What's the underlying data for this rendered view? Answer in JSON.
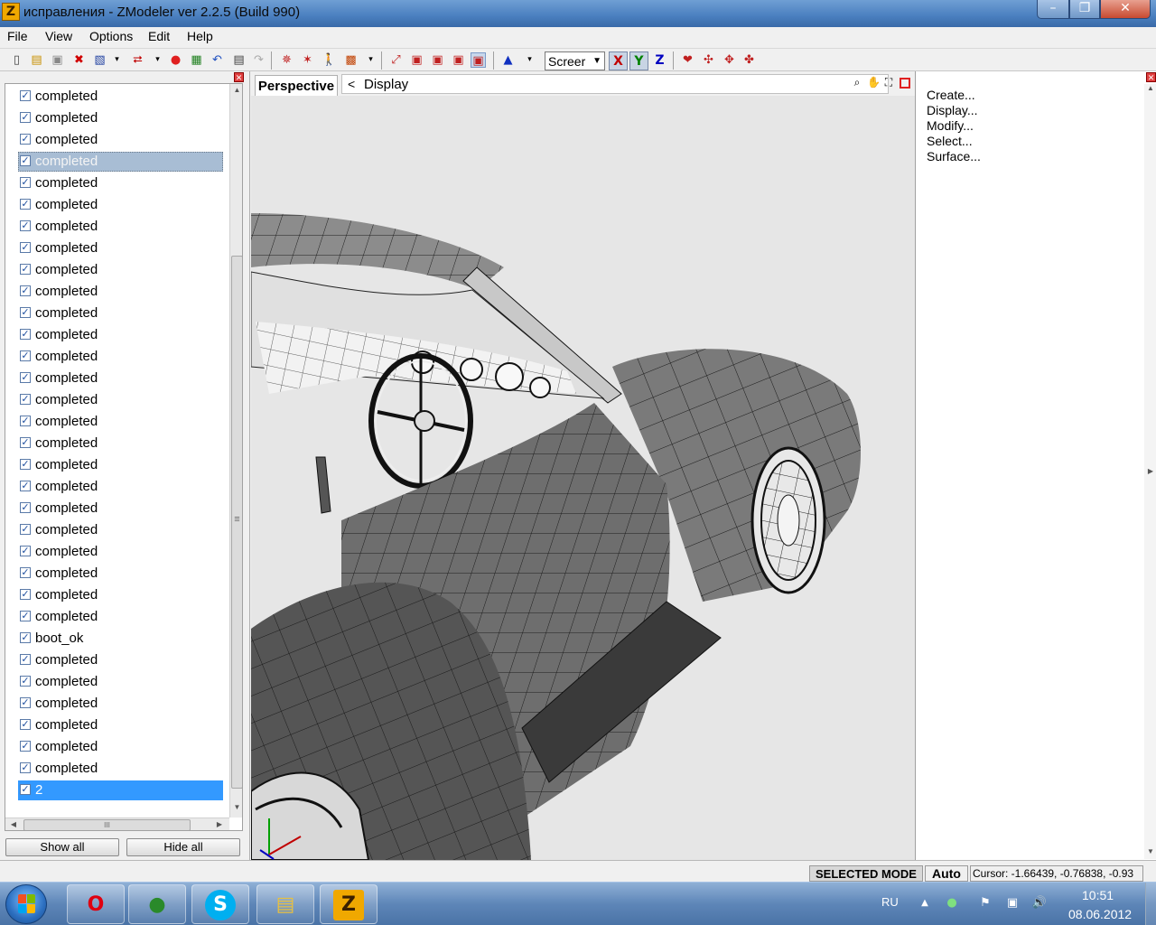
{
  "window": {
    "title": "исправления - ZModeler ver 2.2.5 (Build 990)",
    "app_icon_letter": "Z",
    "minimize_glyph": "–",
    "maximize_glyph": "❐",
    "close_glyph": "✕"
  },
  "menu": {
    "items": [
      "File",
      "View",
      "Options",
      "Edit",
      "Help"
    ]
  },
  "toolbar": {
    "screen_value": "Screer",
    "axis_x": "X",
    "axis_y": "Y",
    "axis_z": "Z",
    "icons": [
      "new-icon",
      "open-icon",
      "save-icon",
      "delete-icon",
      "import-icon",
      "export-icon",
      "record-icon",
      "image-icon",
      "undo-icon",
      "notes-icon",
      "redo-icon",
      "select-vertex-icon",
      "select-point-icon",
      "walk-icon",
      "paint-icon",
      "zoom-extent-icon",
      "cube-a-icon",
      "cube-b-icon",
      "cube-c-icon",
      "cube-d-icon",
      "cone-icon",
      "magnet-icon",
      "axis-move-icon",
      "axis-rotate-icon",
      "axis-scale-icon"
    ],
    "colors": {
      "axis_x": "#c00000",
      "axis_y": "#008000",
      "axis_z": "#0000c0"
    }
  },
  "left_panel": {
    "items": [
      {
        "label": "completed",
        "checked": true,
        "state": "normal"
      },
      {
        "label": "completed",
        "checked": true,
        "state": "normal"
      },
      {
        "label": "completed",
        "checked": true,
        "state": "normal"
      },
      {
        "label": "completed",
        "checked": true,
        "state": "selected-inactive"
      },
      {
        "label": "completed",
        "checked": true,
        "state": "normal"
      },
      {
        "label": "completed",
        "checked": true,
        "state": "normal"
      },
      {
        "label": "completed",
        "checked": true,
        "state": "normal"
      },
      {
        "label": "completed",
        "checked": true,
        "state": "normal"
      },
      {
        "label": "completed",
        "checked": true,
        "state": "normal"
      },
      {
        "label": "completed",
        "checked": true,
        "state": "normal"
      },
      {
        "label": "completed",
        "checked": true,
        "state": "normal"
      },
      {
        "label": "completed",
        "checked": true,
        "state": "normal"
      },
      {
        "label": "completed",
        "checked": true,
        "state": "normal"
      },
      {
        "label": "completed",
        "checked": true,
        "state": "normal"
      },
      {
        "label": "completed",
        "checked": true,
        "state": "normal"
      },
      {
        "label": "completed",
        "checked": true,
        "state": "normal"
      },
      {
        "label": "completed",
        "checked": true,
        "state": "normal"
      },
      {
        "label": "completed",
        "checked": true,
        "state": "normal"
      },
      {
        "label": "completed",
        "checked": true,
        "state": "normal"
      },
      {
        "label": "completed",
        "checked": true,
        "state": "normal"
      },
      {
        "label": "completed",
        "checked": true,
        "state": "normal"
      },
      {
        "label": "completed",
        "checked": true,
        "state": "normal"
      },
      {
        "label": "completed",
        "checked": true,
        "state": "normal"
      },
      {
        "label": "completed",
        "checked": true,
        "state": "normal"
      },
      {
        "label": "completed",
        "checked": true,
        "state": "normal"
      },
      {
        "label": "boot_ok",
        "checked": true,
        "state": "normal"
      },
      {
        "label": "completed",
        "checked": true,
        "state": "normal"
      },
      {
        "label": "completed",
        "checked": true,
        "state": "normal"
      },
      {
        "label": "completed",
        "checked": true,
        "state": "normal"
      },
      {
        "label": "completed",
        "checked": true,
        "state": "normal"
      },
      {
        "label": "completed",
        "checked": true,
        "state": "normal"
      },
      {
        "label": "completed",
        "checked": true,
        "state": "normal"
      },
      {
        "label": "2",
        "checked": true,
        "state": "selected"
      }
    ],
    "show_all": "Show all",
    "hide_all": "Hide all",
    "hscroll_grip": "III",
    "vscroll_grip": "≡"
  },
  "viewport": {
    "tab_label": "Perspective",
    "back_glyph": "<",
    "display_label": "Display",
    "tools": [
      "zoom-icon",
      "pan-icon",
      "fullscreen-icon"
    ]
  },
  "right_panel": {
    "items": [
      "Create...",
      "Display...",
      "Modify...",
      "Select...",
      "Surface..."
    ]
  },
  "status": {
    "mode": "SELECTED MODE",
    "auto": "Auto",
    "cursor": "Cursor: -1.66439, -0.76838, -0.93"
  },
  "taskbar": {
    "apps": [
      {
        "name": "opera",
        "glyph": "O",
        "color": "#e00010"
      },
      {
        "name": "chrome",
        "glyph": "●",
        "color": "#2a8a2a"
      },
      {
        "name": "skype",
        "glyph": "S",
        "color": "#00aff0"
      },
      {
        "name": "explorer",
        "glyph": "▤",
        "color": "#e8c040"
      },
      {
        "name": "zmodeler",
        "glyph": "Z",
        "color": "#f0a800"
      }
    ],
    "lang": "RU",
    "time": "10:51",
    "date": "08.06.2012"
  }
}
